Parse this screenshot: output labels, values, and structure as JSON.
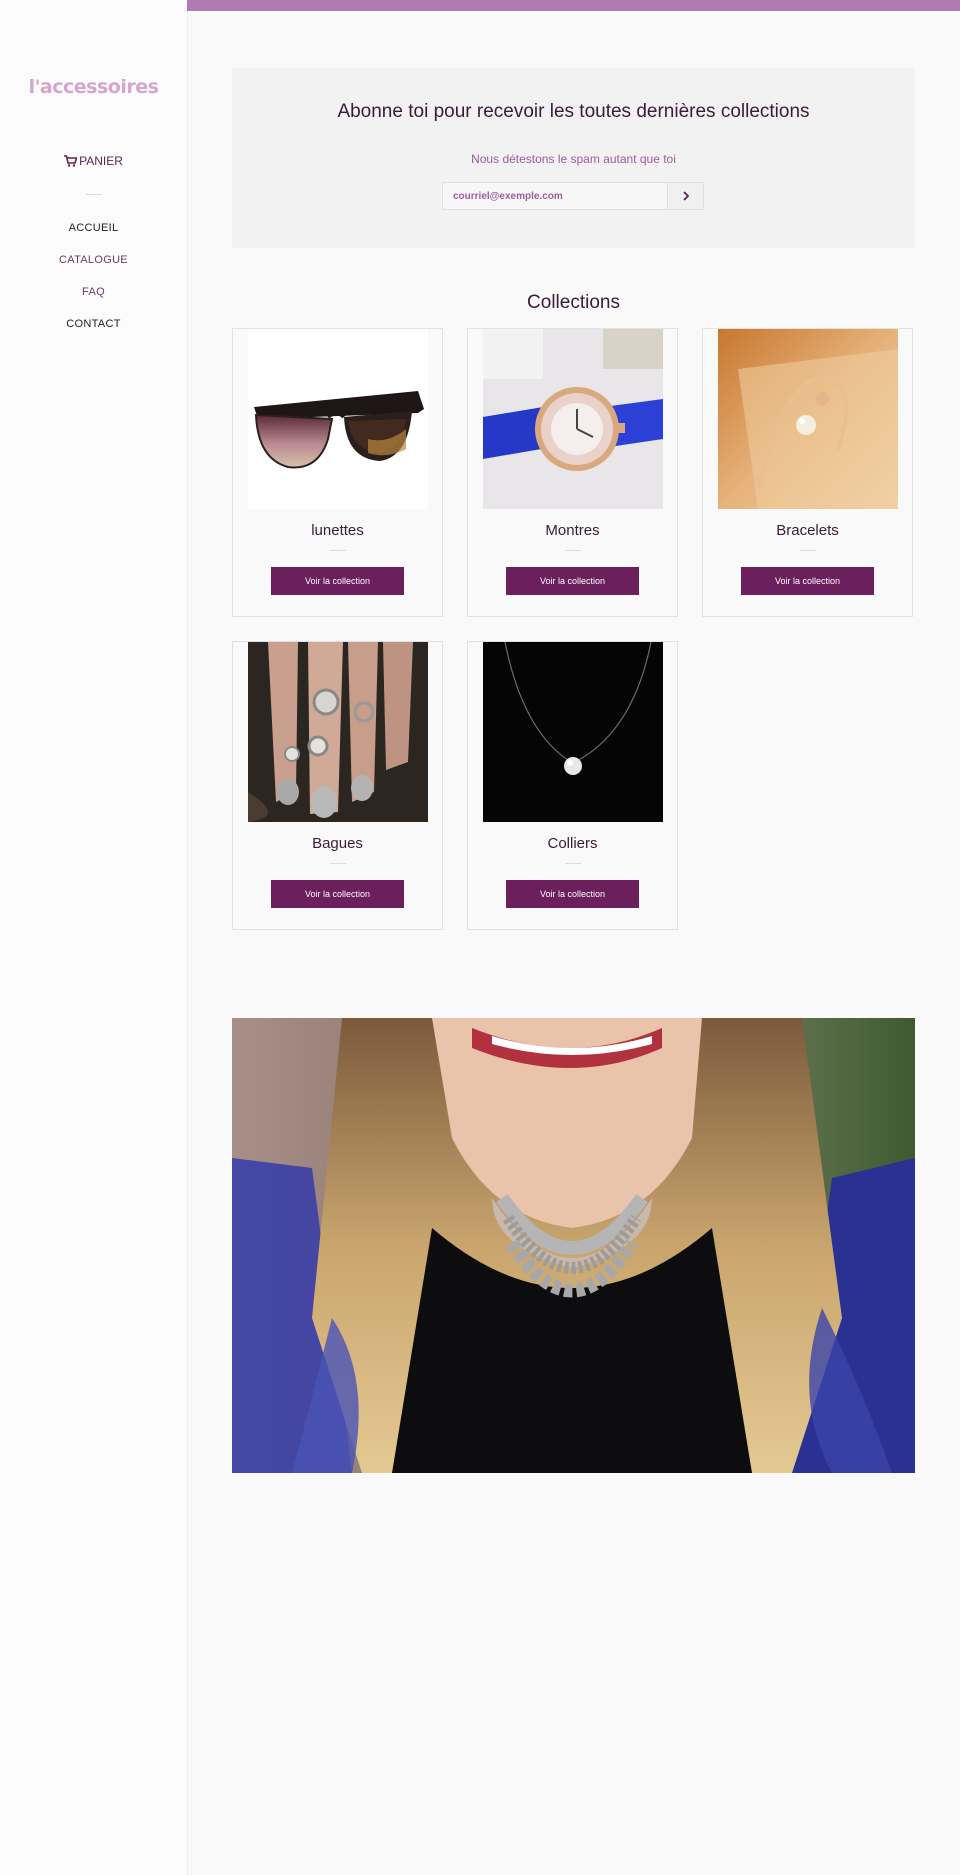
{
  "sidebar": {
    "logo": "l'accessoires",
    "cart_label": "PANIER",
    "nav": [
      {
        "label": "ACCUEIL"
      },
      {
        "label": "CATALOGUE"
      },
      {
        "label": "FAQ"
      },
      {
        "label": "CONTACT"
      }
    ]
  },
  "newsletter": {
    "title": "Abonne toi pour recevoir les toutes dernières collections",
    "subtitle": "Nous détestons le spam autant que toi",
    "email_placeholder": "courriel@exemple.com",
    "submit_icon": "chevron-right-icon"
  },
  "collections": {
    "title": "Collections",
    "button_label": "Voir la collection",
    "items": [
      {
        "title": "lunettes",
        "image": "sunglasses"
      },
      {
        "title": "Montres",
        "image": "watch"
      },
      {
        "title": "Bracelets",
        "image": "bracelet"
      },
      {
        "title": "Bagues",
        "image": "rings"
      },
      {
        "title": "Colliers",
        "image": "necklace"
      }
    ]
  },
  "hero": {
    "image": "woman-wearing-necklace"
  },
  "colors": {
    "accent": "#6b1f5c",
    "top_bar": "#b07ab5",
    "logo": "#d4a6cd",
    "heading": "#3c1a3a"
  }
}
